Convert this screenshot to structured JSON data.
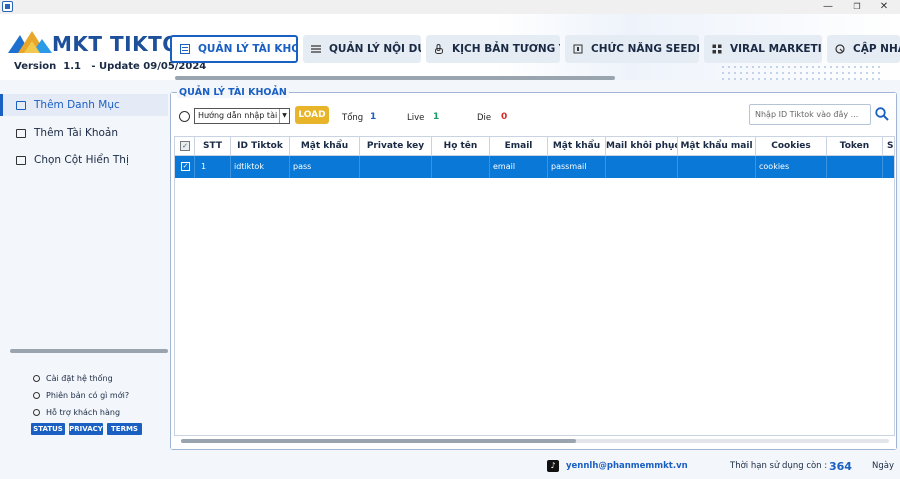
{
  "window": {
    "minimize": "—",
    "restore": "❐",
    "close": "✕"
  },
  "brand": {
    "name": "MKT TIKTOK",
    "version_label": "Version",
    "version": "1.1",
    "update_label": "- Update",
    "update_date": "09/05/2024"
  },
  "tabs": [
    {
      "label": "QUẢN LÝ TÀI KHOẢN",
      "icon": "account-list-icon"
    },
    {
      "label": "QUẢN LÝ NỘI DUNG",
      "icon": "list-icon"
    },
    {
      "label": "KỊCH BẢN TƯƠNG TÁC",
      "icon": "hand-pointer-icon"
    },
    {
      "label": "CHỨC NĂNG SEEDING",
      "icon": "seeding-icon"
    },
    {
      "label": "VIRAL MARKETING",
      "icon": "grid-icon"
    },
    {
      "label": "CẬP NHẬT",
      "icon": "update-icon"
    }
  ],
  "sidebar": {
    "items": [
      {
        "label": "Thêm Danh Mục",
        "icon": "folder-add-icon"
      },
      {
        "label": "Thêm Tài Khoản",
        "icon": "account-add-icon"
      },
      {
        "label": "Chọn Cột Hiển Thị",
        "icon": "monitor-icon"
      }
    ],
    "links": [
      {
        "label": "Cài đặt hệ thống",
        "icon": "gear-icon"
      },
      {
        "label": "Phiên bản có gì mới?",
        "icon": "info-icon"
      },
      {
        "label": "Hỗ trợ khách hàng",
        "icon": "support-icon"
      }
    ],
    "chips": [
      "STATUS",
      "PRIVACY",
      "TERMS"
    ]
  },
  "panel": {
    "title": "QUẢN LÝ TÀI KHOẢN",
    "select_value": "Hướng dẫn nhập tài k",
    "load_label": "LOAD",
    "stats": {
      "total_label": "Tổng",
      "total": "1",
      "live_label": "Live",
      "live": "1",
      "die_label": "Die",
      "die": "0"
    },
    "search_placeholder": "Nhập ID Tiktok vào đây ..."
  },
  "table": {
    "columns": [
      "",
      "STT",
      "ID Tiktok",
      "Mật khẩu",
      "Private key",
      "Họ tên",
      "Email",
      "Mật khẩu",
      "Mail khôi phục",
      "Mật khẩu mail",
      "Cookies",
      "Token",
      "S"
    ],
    "rows": [
      [
        "✓",
        "1",
        "idtiktok",
        "pass",
        "",
        "",
        "email",
        "passmail",
        "",
        "",
        "cookies",
        "",
        ""
      ]
    ]
  },
  "footer": {
    "email": "yennlh@phanmemmkt.vn",
    "expire_label": "Thời hạn sử dụng còn :",
    "expire_days": "364",
    "expire_unit": "Ngày"
  },
  "colors": {
    "accent": "#1a5fc2",
    "selected_row": "#0a78d7",
    "load_button": "#e8b42a"
  }
}
